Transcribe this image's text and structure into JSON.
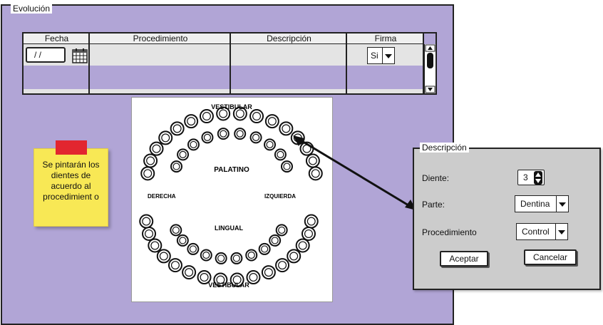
{
  "evolucion": {
    "title": "Evolución",
    "table": {
      "columns": [
        "Fecha",
        "Procedimiento",
        "Descripción",
        "Firma"
      ],
      "date_value": "/ /",
      "firma_value": "Si"
    }
  },
  "odontogram": {
    "labels": {
      "top": "VESTIBULAR",
      "bottom": "VESTIBULAR",
      "upper_center": "PALATINO",
      "lower_center": "LINGUAL",
      "left": "DERECHA",
      "right": "IZQUIERDA"
    }
  },
  "note": {
    "text": "Se pintarán los dientes de acuerdo al procedimient o"
  },
  "descripcion": {
    "title": "Descripción",
    "diente_label": "Diente:",
    "diente_value": "3",
    "parte_label": "Parte:",
    "parte_value": "Dentina",
    "procedimiento_label": "Procedimiento",
    "procedimiento_value": "Control",
    "accept_label": "Aceptar",
    "cancel_label": "Cancelar"
  }
}
